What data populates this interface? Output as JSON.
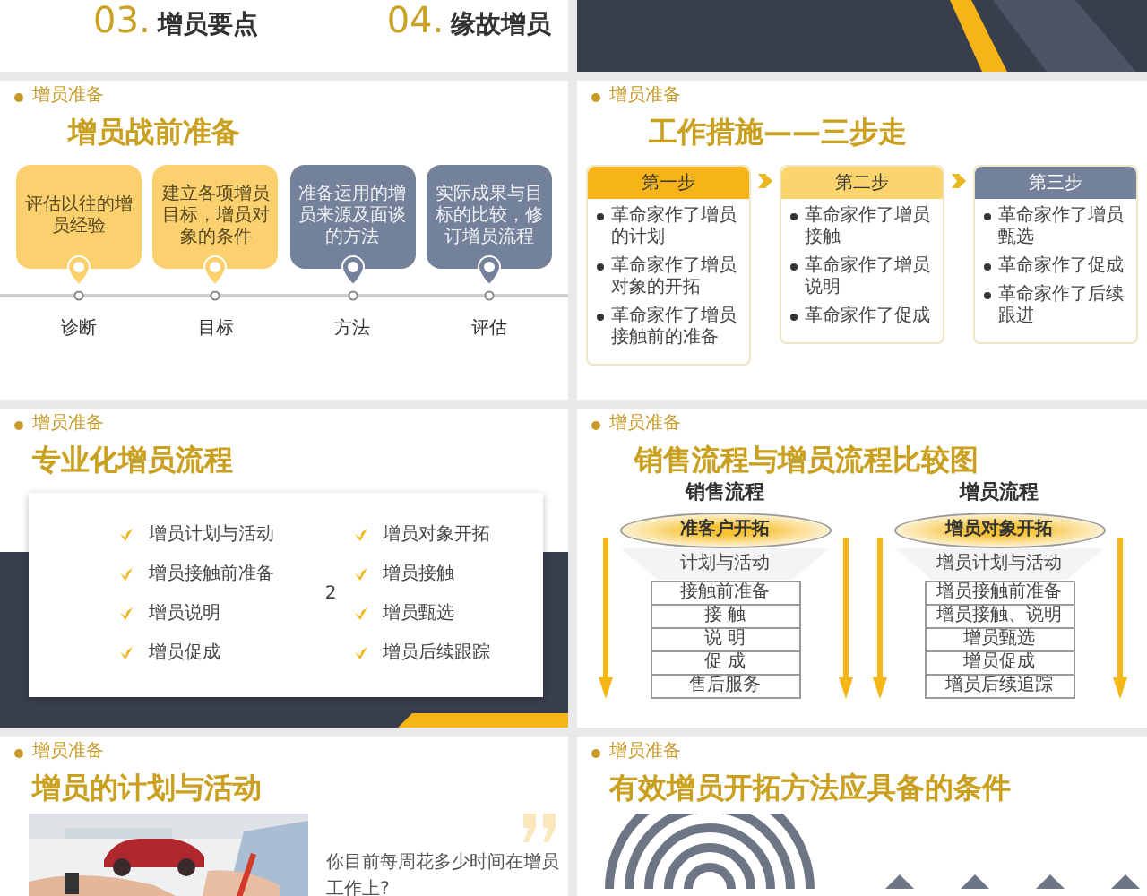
{
  "slides": [
    {
      "kind": "agenda",
      "items": [
        {
          "number": "03.",
          "label": "增员要点"
        },
        {
          "number": "04.",
          "label": "缘故增员"
        }
      ]
    },
    {
      "kind": "cover"
    },
    {
      "kind": "timeline",
      "tag": "增员准备",
      "title": "增员战前准备",
      "steps": [
        {
          "text": "评估以往的增员经验",
          "label": "诊断",
          "color": "#fbd06f"
        },
        {
          "text": "建立各项增员目标，增员对象的条件",
          "label": "目标",
          "color": "#fbd06f"
        },
        {
          "text": "准备运用的增员来源及面谈的方法",
          "label": "方法",
          "color": "#74819a"
        },
        {
          "text": "实际成果与目标的比较，修订增员流程",
          "label": "评估",
          "color": "#74819a"
        }
      ]
    },
    {
      "kind": "steps",
      "tag": "增员准备",
      "title": "工作措施——三步走",
      "columns": [
        {
          "heading": "第一步",
          "color": "#f7b418",
          "items": [
            "革命家作了增员的计划",
            "革命家作了增员对象的开拓",
            "革命家作了增员接触前的准备"
          ]
        },
        {
          "heading": "第二步",
          "color": "#fcd46e",
          "items": [
            "革命家作了增员接触",
            "革命家作了增员说明",
            "革命家作了促成"
          ]
        },
        {
          "heading": "第三步",
          "color": "#74819a",
          "items": [
            "革命家作了增员甄选",
            "革命家作了促成",
            "革命家作了后续跟进"
          ]
        }
      ]
    },
    {
      "kind": "checklist",
      "tag": "增员准备",
      "title": "专业化增员流程",
      "page_mark": "2",
      "items": [
        "增员计划与活动",
        "增员接触前准备",
        "增员说明",
        "增员促成",
        "增员对象开拓",
        "增员接触",
        "增员甄选",
        "增员后续跟踪"
      ]
    },
    {
      "kind": "funnels",
      "tag": "增员准备",
      "title": "销售流程与增员流程比较图",
      "funnels": [
        {
          "title": "销售流程",
          "top": "准客户开拓",
          "neck": "计划与活动",
          "rows": [
            "接触前准备",
            "接 触",
            "说 明",
            "促 成",
            "售后服务"
          ]
        },
        {
          "title": "增员流程",
          "top": "增员对象开拓",
          "neck": "增员计划与活动",
          "rows": [
            "增员接触前准备",
            "增员接触、说明",
            "增员甄选",
            "增员促成",
            "增员后续追踪"
          ]
        }
      ]
    },
    {
      "tag": "增员准备",
      "title": "增员的计划与活动",
      "question": "你目前每周花多少时间在增员工作上?"
    },
    {
      "kind": "rings",
      "tag": "增员准备",
      "title": "有效增员开拓方法应具备的条件"
    }
  ]
}
